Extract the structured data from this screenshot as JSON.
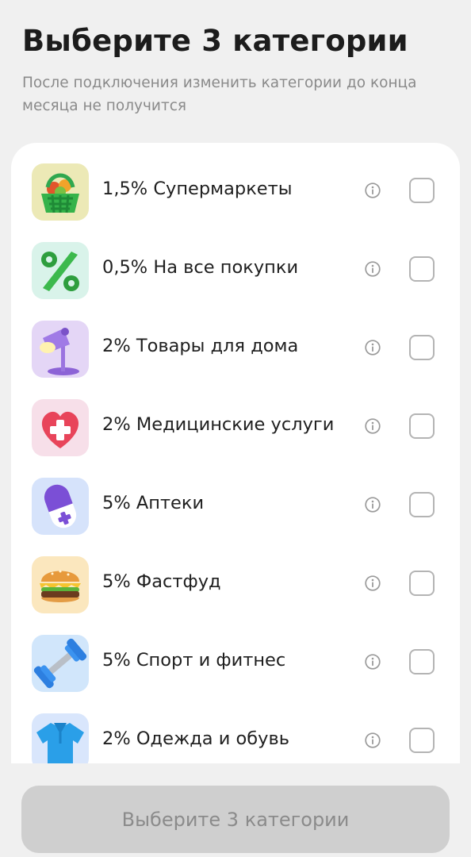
{
  "header": {
    "title": "Выберите 3 категории",
    "subtitle": "После подключения изменить категории до конца месяца не получится"
  },
  "categories": [
    {
      "label": "1,5% Супермаркеты",
      "icon": "grocery-basket-icon",
      "tile_color": "#ece9b6"
    },
    {
      "label": "0,5% На все покупки",
      "icon": "percent-icon",
      "tile_color": "#d9f3ea"
    },
    {
      "label": "2% Товары для дома",
      "icon": "desk-lamp-icon",
      "tile_color": "#e4d6f6"
    },
    {
      "label": "2% Медицинские услуги",
      "icon": "heart-cross-icon",
      "tile_color": "#f7dfe9"
    },
    {
      "label": "5% Аптеки",
      "icon": "pill-capsule-icon",
      "tile_color": "#d6e3fb"
    },
    {
      "label": "5% Фастфуд",
      "icon": "burger-icon",
      "tile_color": "#fbe7be"
    },
    {
      "label": "5% Спорт и фитнес",
      "icon": "dumbbell-icon",
      "tile_color": "#d1e6fb"
    },
    {
      "label": "2% Одежда и обувь",
      "icon": "polo-shirt-icon",
      "tile_color": "#d9e6fc"
    }
  ],
  "footer": {
    "button_label": "Выберите 3 категории"
  }
}
